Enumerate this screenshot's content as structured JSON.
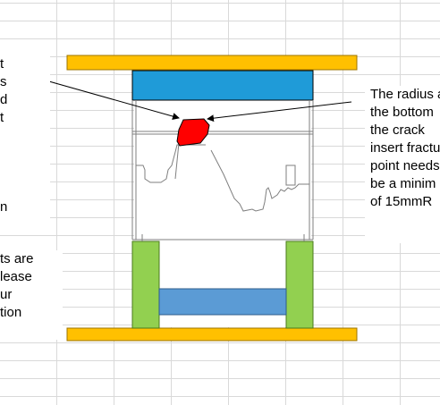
{
  "spreadsheet": {
    "gridlines": true,
    "gridline_color": "#d9d9d9"
  },
  "callouts": {
    "left_top": "t\ns\nd\nt\n\n\n\n\nn",
    "left_bottom": "ts are\nlease\nur\ntion",
    "right": "The radius a\nthe bottom\nthe crack\ninsert fractu\npoint needs\nbe a minim\nof 15mmR"
  },
  "colors": {
    "platen": "#ffc000",
    "top_block": "#1f9bd8",
    "highlight_insert": "#ff0000",
    "support_pillars": "#92d050",
    "cross_beam": "#5b9bd5",
    "outline": "#7f7f7f",
    "arrow": "#000000"
  }
}
